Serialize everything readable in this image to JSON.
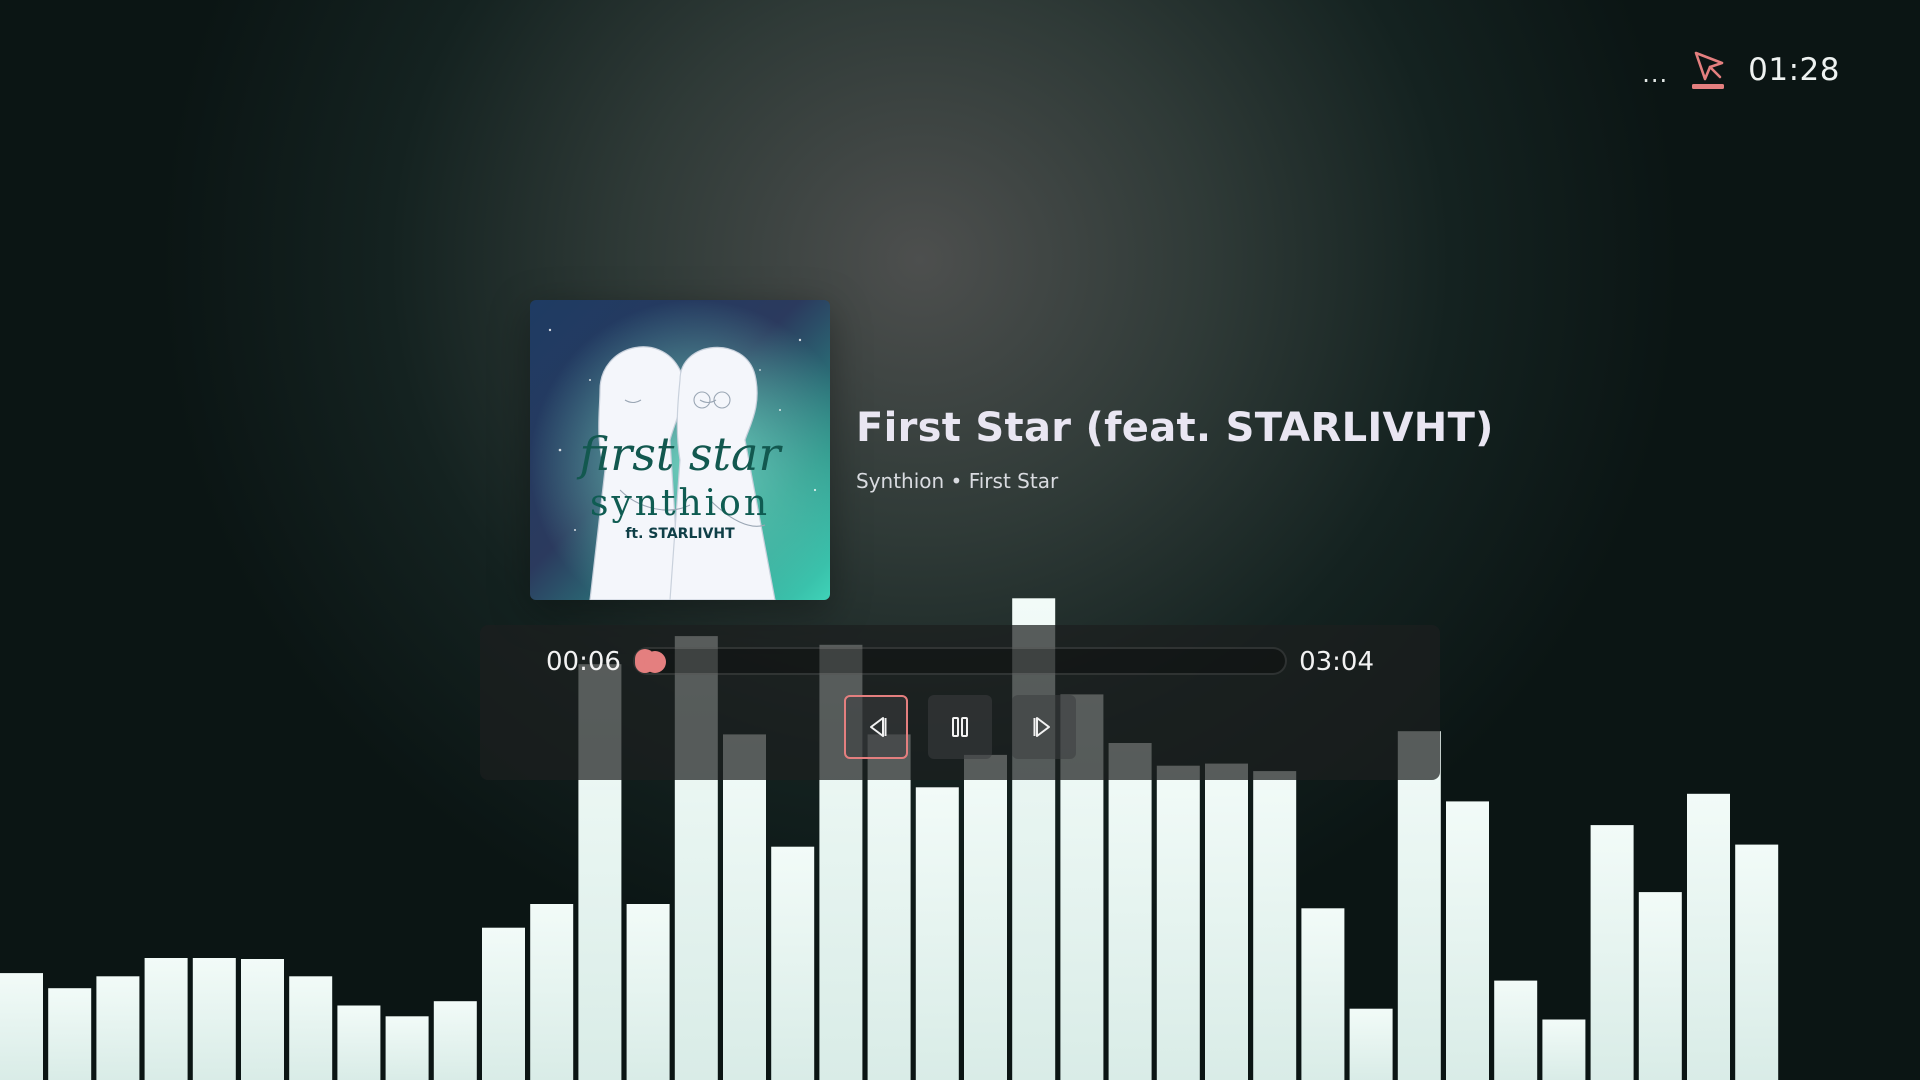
{
  "status": {
    "more_label": "...",
    "clock": "01:28",
    "cast_icon": "cast-pointer-icon"
  },
  "track": {
    "title": "First Star (feat. STARLIVHT)",
    "subtitle": "Synthion • First Star",
    "cover_art": {
      "script_text": "first star",
      "artist_text": "synthion",
      "feat_text": "ft. STARLIVHT"
    }
  },
  "player": {
    "current_time": "00:06",
    "total_time": "03:04",
    "progress": 0.03,
    "controls": [
      {
        "name": "previous",
        "icon": "skip-previous-icon",
        "focused": true
      },
      {
        "name": "pause",
        "icon": "pause-icon",
        "focused": false
      },
      {
        "name": "next",
        "icon": "skip-next-icon",
        "focused": false
      }
    ]
  },
  "visualizer": {
    "levels": [
      0.099,
      0.085,
      0.096,
      0.113,
      0.113,
      0.112,
      0.096,
      0.069,
      0.059,
      0.073,
      0.141,
      0.163,
      0.385,
      0.163,
      0.411,
      0.32,
      0.216,
      0.403,
      0.32,
      0.271,
      0.301,
      0.446,
      0.357,
      0.312,
      0.291,
      0.293,
      0.286,
      0.159,
      0.066,
      0.323,
      0.258,
      0.092,
      0.056,
      0.236,
      0.174,
      0.265,
      0.218
    ],
    "color_top": "#f2fbf8",
    "color_bottom": "#d9ece7"
  },
  "colors": {
    "accent": "#e47f7f",
    "text": "#e9e6f2",
    "panel": "#1c1e1f"
  }
}
